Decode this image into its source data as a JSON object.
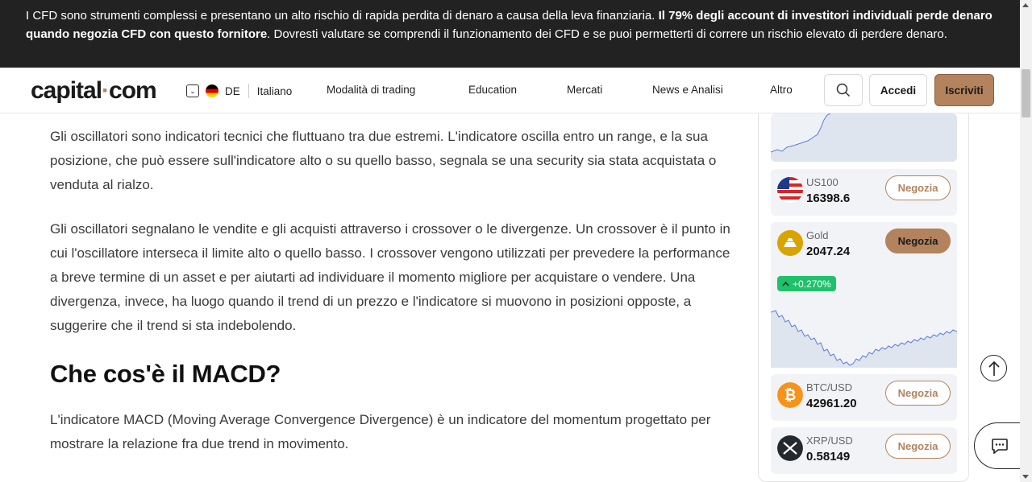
{
  "risk_banner": {
    "text_before": "I CFD sono strumenti complessi e presentano un alto rischio di rapida perdita di denaro a causa della leva finanziaria. ",
    "text_bold": "Il 79% degli account di investitori individuali perde denaro quando negozia CFD con questo fornitore",
    "text_after": ". Dovresti valutare se comprendi il funzionamento dei CFD e se puoi permetterti di correre un rischio elevato di perdere denaro."
  },
  "header": {
    "logo_left": "capital",
    "logo_dot": "·",
    "logo_right": "com",
    "region_code": "DE",
    "language": "Italiano",
    "nav": [
      "Modalità di trading",
      "Education",
      "Mercati",
      "News e Analisi",
      "Altro"
    ],
    "login_label": "Accedi",
    "signup_label": "Iscriviti"
  },
  "article": {
    "p1": "Gli oscillatori sono indicatori tecnici che fluttuano tra due estremi. L'indicatore oscilla entro un range, e la sua posizione, che può essere sull'indicatore alto o su quello basso, segnala se una security sia stata acquistata o venduta al rialzo.",
    "p2": "Gli oscillatori segnalano le vendite e gli acquisti attraverso i crossover o le divergenze. Un crossover è il punto in cui l'oscillatore interseca il limite alto o quello basso. I crossover vengono utilizzati per prevedere la performance a breve termine di un asset e per aiutarti ad individuare il momento migliore per acquistare o vendere. Una divergenza, invece, ha luogo quando il trend di un prezzo e l'indicatore si muovono in posizioni opposte, a suggerire che il trend si sta indebolendo.",
    "h2": "Che cos'è il MACD?",
    "p3": "L'indicatore MACD (Moving Average Convergence Divergence) è un indicatore del momentum progettato per mostrare la relazione fra due trend in movimento."
  },
  "sidebar": {
    "assets": [
      {
        "name": "US100",
        "price": "16398.6",
        "button": "Negozia",
        "icon": "us-flag-icon"
      },
      {
        "name": "Gold",
        "price": "2047.24",
        "button": "Negozia",
        "change": "+0.270%",
        "icon": "gold-icon"
      },
      {
        "name": "BTC/USD",
        "price": "42961.20",
        "button": "Negozia",
        "icon": "bitcoin-icon"
      },
      {
        "name": "XRP/USD",
        "price": "0.58149",
        "button": "Negozia",
        "icon": "xrp-icon"
      }
    ],
    "accent_color": "#b3835d",
    "positive_color": "#1fc16b"
  }
}
